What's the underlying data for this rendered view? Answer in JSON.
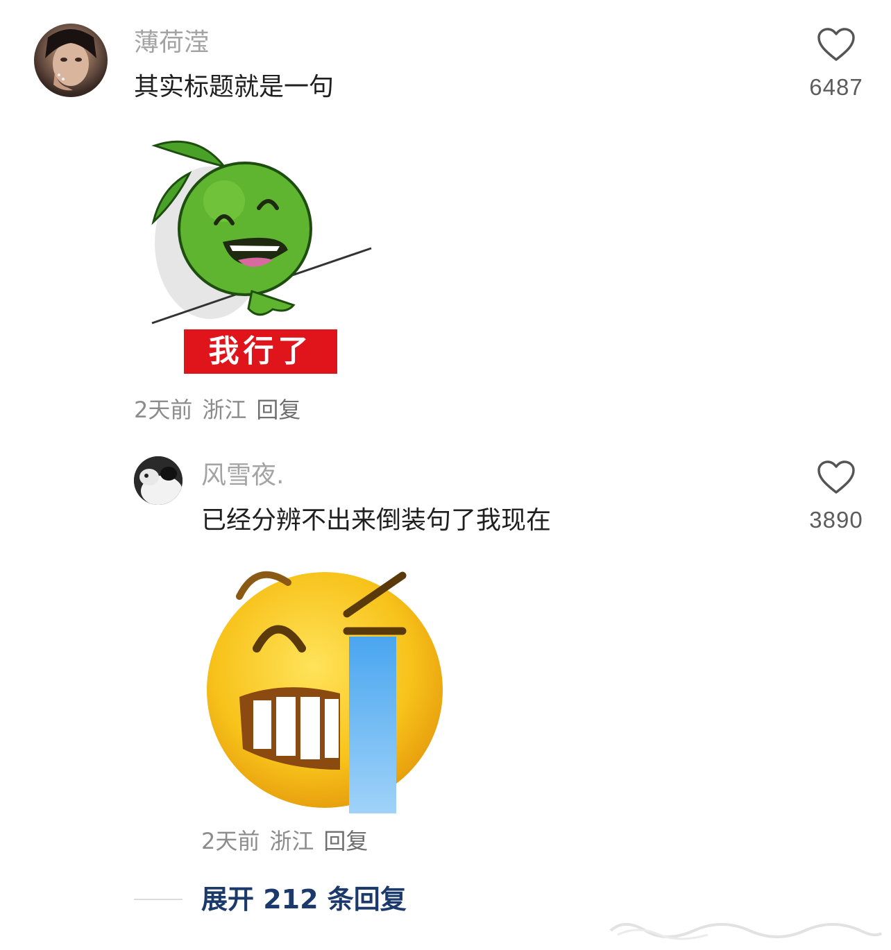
{
  "comments": [
    {
      "username": "薄荷滢",
      "text": "其实标题就是一句",
      "sticker_caption": "我行了",
      "time": "2天前",
      "location": "浙江",
      "reply_label": "回复",
      "likes": "6487"
    }
  ],
  "replies": [
    {
      "username": "风雪夜.",
      "text": "已经分辨不出来倒装句了我现在",
      "time": "2天前",
      "location": "浙江",
      "reply_label": "回复",
      "likes": "3890"
    }
  ],
  "expand_replies_label": "展开 212 条回复",
  "icons": {
    "like": "heart-outline-icon",
    "sticker1": "green-lime-mascot",
    "sticker2": "laughing-crying-emoji"
  },
  "colors": {
    "username": "#a3a3a3",
    "text": "#1f1f1f",
    "expand_link": "#1b3a6b",
    "sticker_label_bg": "#e0141b"
  }
}
